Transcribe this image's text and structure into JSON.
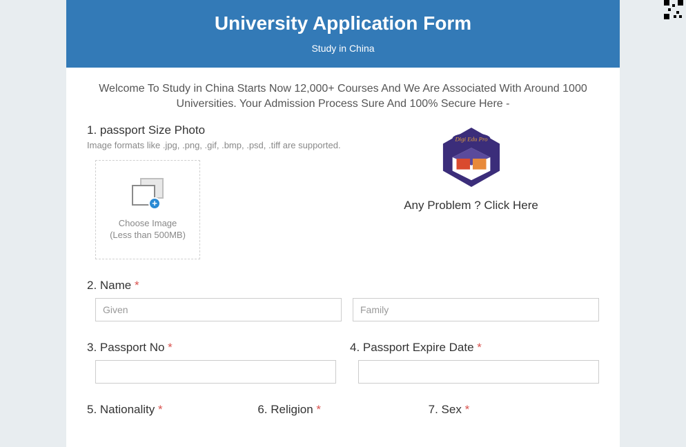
{
  "header": {
    "title": "University Application Form",
    "subtitle": "Study in China"
  },
  "welcome_text": "Welcome To Study in China Starts Now 12,000+ Courses And We Are Associated With Around 1000 Universities. Your Admission Process Sure And 100% Secure Here -",
  "upload": {
    "label": "1. passport Size Photo",
    "hint": "Image formats like .jpg, .png, .gif, .bmp, .psd, .tiff are supported.",
    "choose_label": "Choose Image",
    "size_label": "(Less than 500MB)"
  },
  "help": {
    "logo_text": "Digi Edu Pro",
    "link_text": "Any Problem ? Click Here"
  },
  "fields": {
    "name": {
      "label": "2. Name ",
      "given_placeholder": "Given",
      "family_placeholder": "Family"
    },
    "passport_no": {
      "label": "3. Passport No  "
    },
    "passport_expire": {
      "label": "4. Passport Expire Date "
    },
    "nationality": {
      "label": "5. Nationality  "
    },
    "religion": {
      "label": "6. Religion "
    },
    "sex": {
      "label": "7. Sex "
    }
  },
  "required_mark": "*"
}
